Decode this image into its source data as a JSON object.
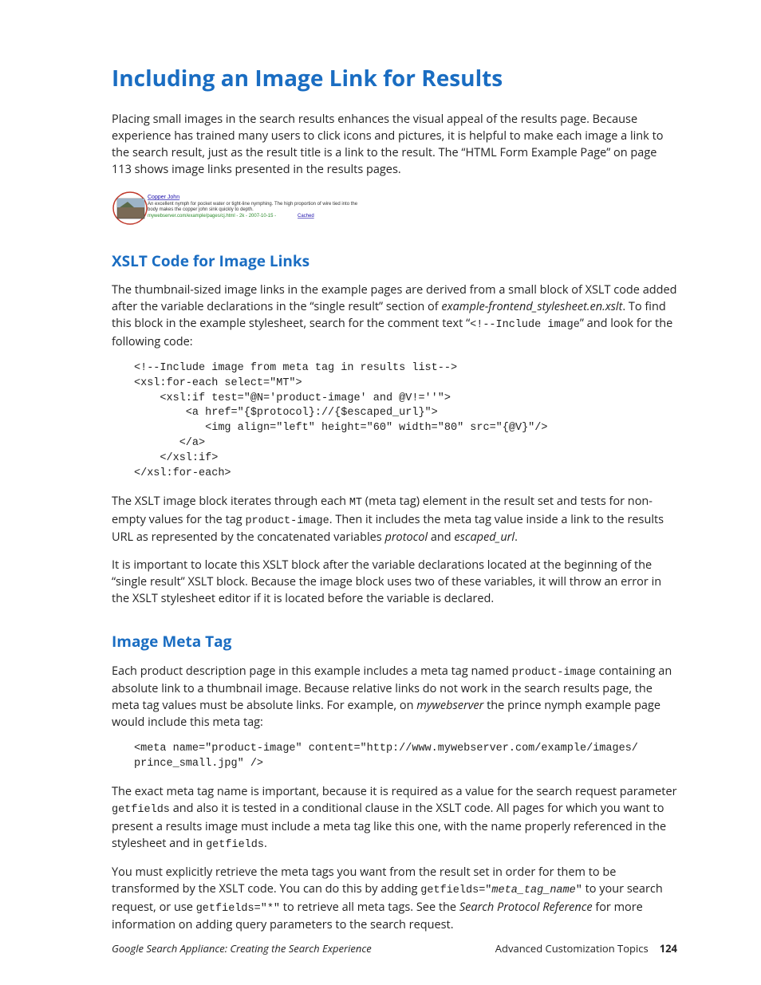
{
  "h1": "Including an Image Link for Results",
  "p1a": "Placing small images in the search results enhances the visual appeal of the results page. Because experience has trained many users to click icons and pictures, it is helpful to make each image a link to the search result, just as the result title is a link to the result. The “HTML Form Example Page” on page 113 shows image links presented in the results pages.",
  "thumb": {
    "title": "Copper John",
    "desc1": "An excellent nymph for pocket water or tight-line nymphing. The high proportion of wire tied into the",
    "desc2": "body makes the copper john sink quickly to depth.",
    "url_part": "mywebserver.com/example/pages/cj.html - 2k - 2007-10-15 - ",
    "cached": "Cached"
  },
  "h2a": "XSLT Code for Image Links",
  "p2a_1": "The thumbnail-sized image links in the example pages are derived from a small block of XSLT code added after the variable declarations in the “single result” section of ",
  "p2a_file": "example-frontend_stylesheet.en.xslt",
  "p2a_2": ". To find this block in the example stylesheet, search for the comment text “",
  "p2a_code": "<!--Include image",
  "p2a_3": "” and look for the following code:",
  "code1": "<!--Include image from meta tag in results list-->\n<xsl:for-each select=\"MT\">\n    <xsl:if test=\"@N='product-image' and @V!=''\">\n        <a href=\"{$protocol}://{$escaped_url}\">\n           <img align=\"left\" height=\"60\" width=\"80\" src=\"{@V}\"/>\n       </a>\n    </xsl:if>\n</xsl:for-each>",
  "p3_1": "The XSLT image block iterates through each ",
  "p3_mt": "MT",
  "p3_2": " (meta tag) element in the result set and tests for non-empty values for the tag ",
  "p3_pi": "product-image",
  "p3_3": ". Then it includes the meta tag value inside a link to the results URL as represented by the concatenated variables ",
  "p3_proto": "protocol",
  "p3_4": " and ",
  "p3_esc": "escaped_url",
  "p3_5": ".",
  "p4": "It is important to locate this XSLT block after the variable declarations located at the beginning of the “single result” XSLT block. Because the image block uses two of these variables, it will throw an error in the XSLT stylesheet editor if it is located before the variable is declared.",
  "h2b": "Image Meta Tag",
  "p5_1": "Each product description page in this example includes a meta tag named ",
  "p5_pi": "product-image",
  "p5_2": " containing an absolute link to a thumbnail image. Because relative links do not work in the search results page, the meta tag values must be absolute links. For example, on ",
  "p5_srv": "mywebserver",
  "p5_3": " the prince nymph example page would include this meta tag:",
  "code2": "<meta name=\"product-image\" content=\"http://www.mywebserver.com/example/images/\nprince_small.jpg\" />",
  "p6_1": "The exact meta tag name is important, because it is required as a value for the search request parameter ",
  "p6_gf": "getfields",
  "p6_2": " and also it is tested in a conditional clause in the XSLT code. All pages for which you want to present a results image must include a meta tag like this one, with the name properly referenced in the stylesheet and in ",
  "p6_3": ".",
  "p7_1": "You must explicitly retrieve the meta tags you want from the result set in order for them to be transformed by the XSLT code. You can do this by adding ",
  "p7_c1a": "getfields=\"",
  "p7_c1b": "meta_tag_name",
  "p7_c1c": "\"",
  "p7_2": " to your search request, or use ",
  "p7_c2": "getfields=\"*\"",
  "p7_3": " to retrieve all meta tags. See the ",
  "p7_ref": "Search Protocol Reference",
  "p7_4": " for more information on adding query parameters to the search request.",
  "footer_left": "Google Search Appliance: Creating the Search Experience",
  "footer_right": "Advanced Customization Topics",
  "page_num": "124"
}
